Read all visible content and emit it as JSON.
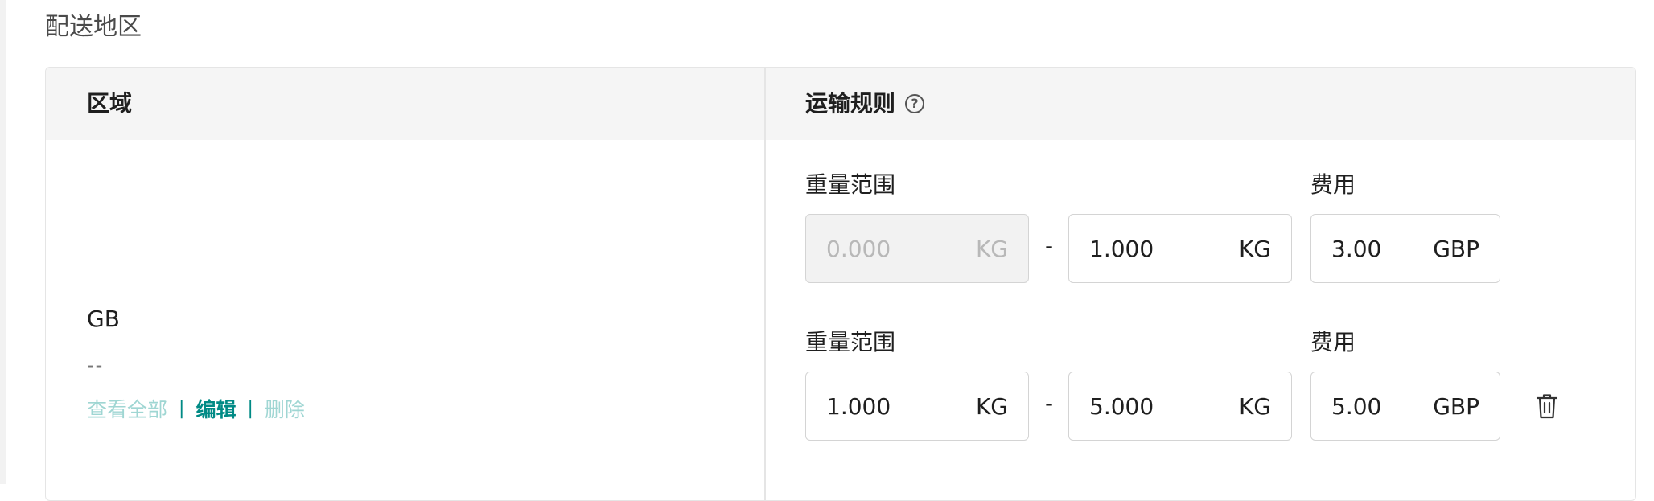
{
  "section": {
    "title": "配送地区"
  },
  "table": {
    "headers": {
      "region": "区域",
      "rule": "运输规则"
    }
  },
  "region": {
    "name": "GB",
    "sub": "--",
    "actions": {
      "view_all": "查看全部",
      "sep": "|",
      "edit": "编辑",
      "delete": "删除"
    }
  },
  "rules": [
    {
      "range_label": "重量范围",
      "fee_label": "费用",
      "min": "0.000",
      "min_placeholder": true,
      "min_unit": "KG",
      "dash": "-",
      "max": "1.000",
      "max_unit": "KG",
      "fee": "3.00",
      "fee_unit": "GBP"
    },
    {
      "range_label": "重量范围",
      "fee_label": "费用",
      "min": "1.000",
      "min_unit": "KG",
      "dash": "-",
      "max": "5.000",
      "max_unit": "KG",
      "fee": "5.00",
      "fee_unit": "GBP"
    }
  ],
  "icons": {
    "help": "help-circle-icon",
    "delete": "trash-icon"
  },
  "colors": {
    "accent": "#008a85",
    "accent_light": "#9fd6d3",
    "header_bg": "#f5f5f5"
  }
}
